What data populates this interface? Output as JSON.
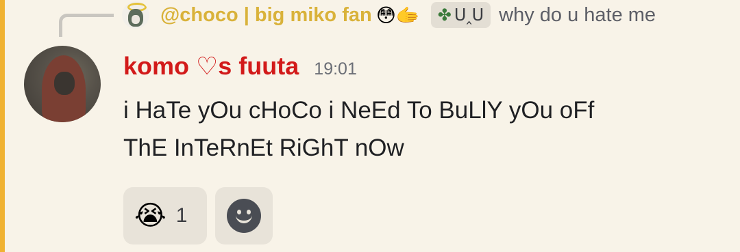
{
  "reply": {
    "author": "@choco | big miko fan",
    "author_emoji": "😳🫱",
    "chip_icon": "clover-icon",
    "chip_text": "ᑌ‸ᑌ",
    "text": "why do u hate me"
  },
  "message": {
    "author": "komo ♡s fuuta",
    "timestamp": "19:01",
    "lines": [
      "i HaTe yOu cHoCo i NeEd To BuLlY yOu oFf",
      "ThE InTeRnEt RiGhT nOw"
    ]
  },
  "reactions": [
    {
      "emoji": "😭",
      "count": "1"
    }
  ],
  "colors": {
    "author": "#d21a1a",
    "reply_author": "#d9b23a",
    "mention_bar": "#f0b232",
    "background": "#f8f3e8"
  }
}
